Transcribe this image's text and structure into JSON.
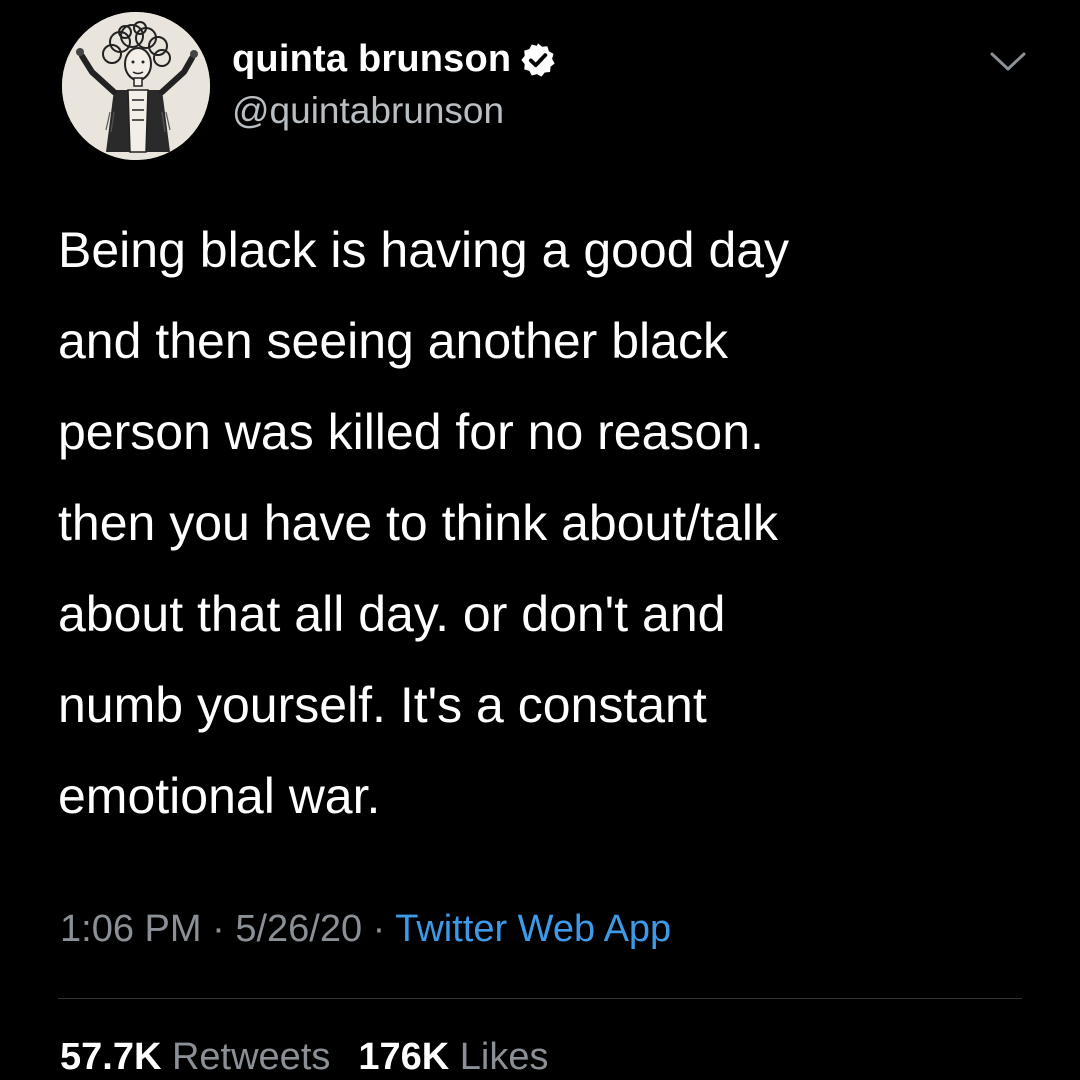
{
  "author": {
    "display_name": "quinta brunson",
    "handle": "@quintabrunson",
    "verified_icon": "verified-badge-icon",
    "avatar_icon": "avatar-illustration"
  },
  "menu_icon": "chevron-down-icon",
  "tweet": {
    "text_lines": [
      "Being black is having a good day",
      "and then seeing another black",
      "person was killed for no reason.",
      "then you have to think about/talk",
      "about that all day. or don't and",
      "numb yourself. It's a constant",
      "emotional war."
    ]
  },
  "meta": {
    "time": "1:06 PM",
    "separator1": " · ",
    "date": "5/26/20",
    "separator2": " · ",
    "source": "Twitter Web App"
  },
  "stats": {
    "retweets_count": "57.7K",
    "retweets_label": "Retweets",
    "likes_count": "176K",
    "likes_label": "Likes"
  },
  "colors": {
    "background": "#000000",
    "text": "#ffffff",
    "secondary_text": "#8a9096",
    "link": "#3d9ae8",
    "divider": "#2f3336"
  }
}
